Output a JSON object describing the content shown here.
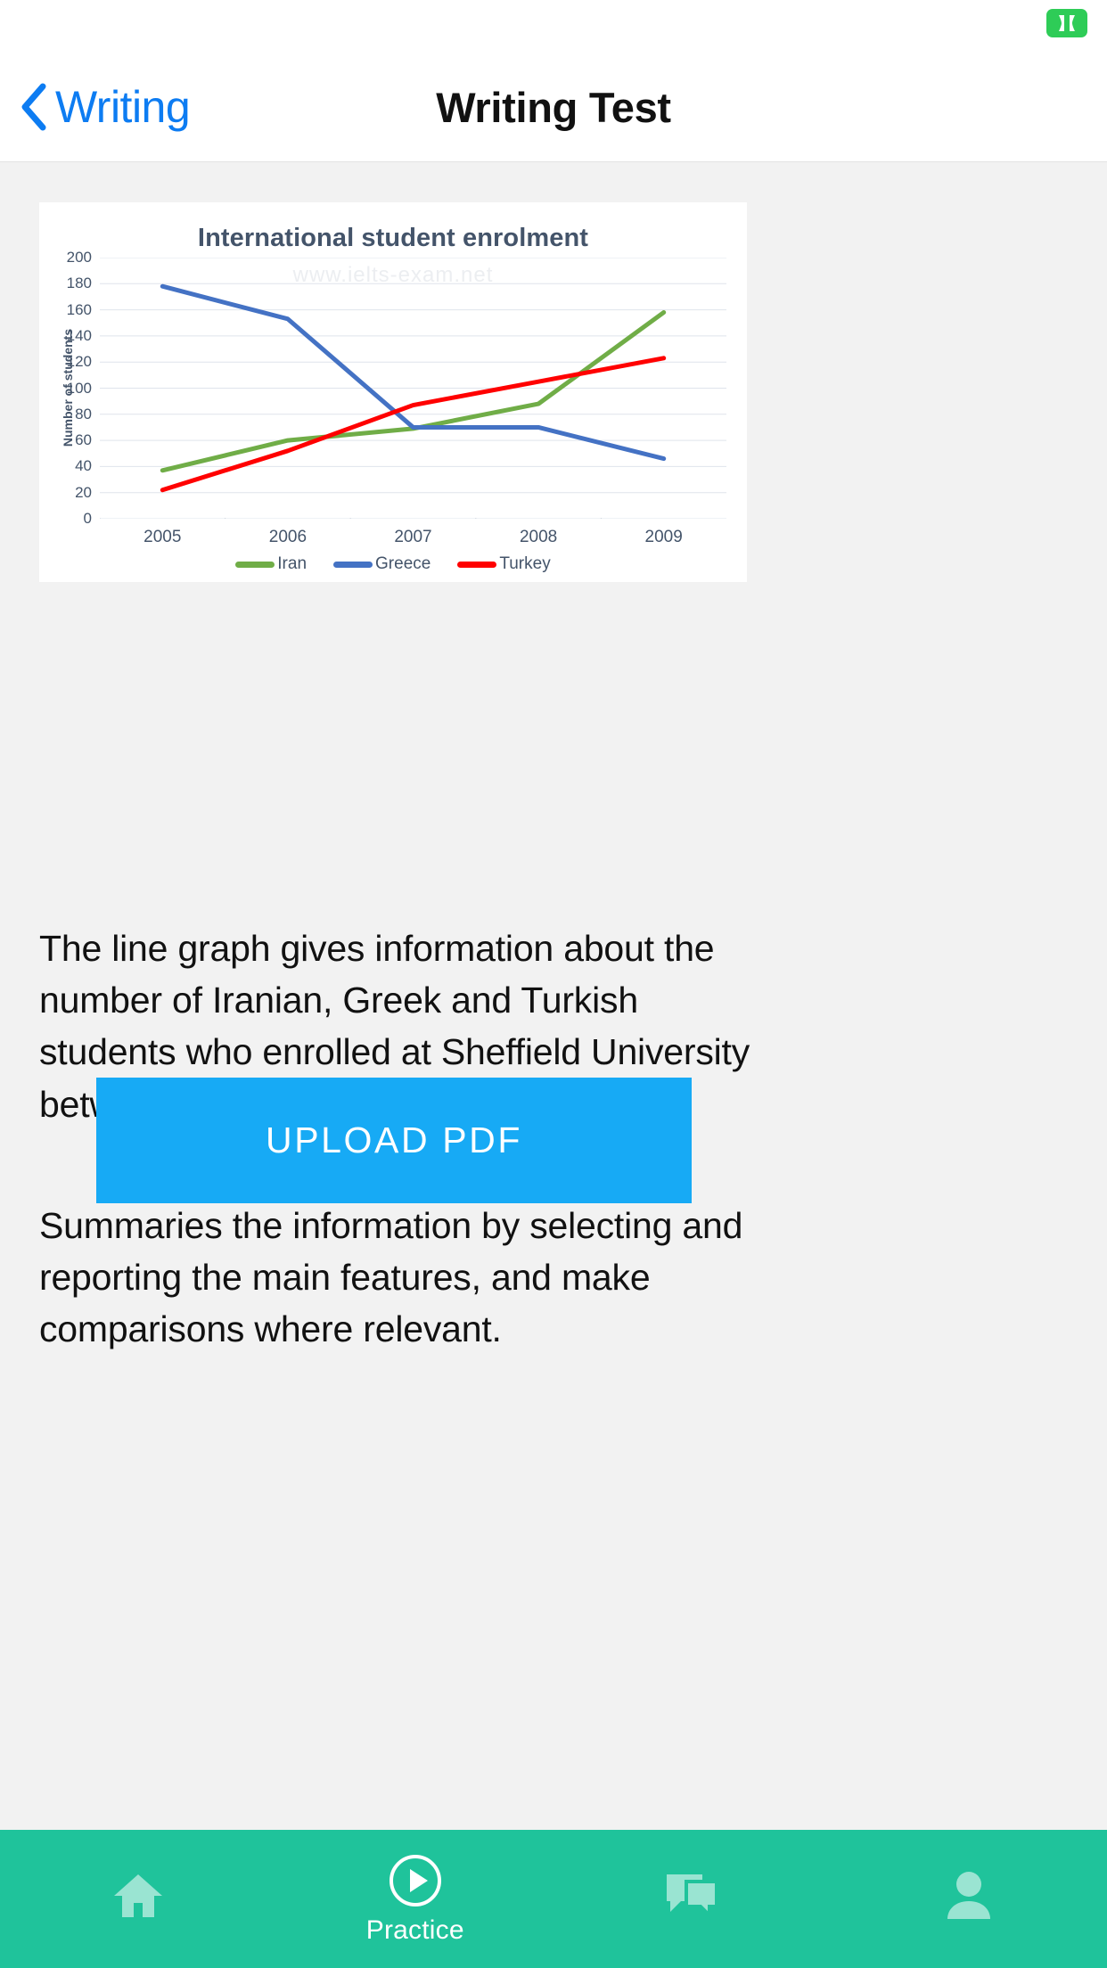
{
  "header": {
    "back_label": "Writing",
    "title": "Writing Test",
    "back_icon": "chevron-left-icon",
    "quote_icon": "quote-badge-icon"
  },
  "chart_data": {
    "type": "line",
    "title": "International student enrolment",
    "watermark": "www.ielts-exam.net",
    "xlabel": "",
    "ylabel": "Number of students",
    "categories": [
      "2005",
      "2006",
      "2007",
      "2008",
      "2009"
    ],
    "ylim": [
      0,
      200
    ],
    "yticks": [
      200,
      180,
      160,
      140,
      120,
      100,
      80,
      60,
      40,
      20,
      0
    ],
    "grid": true,
    "legend_position": "bottom",
    "series": [
      {
        "name": "Iran",
        "color": "#70ad47",
        "values": [
          37,
          60,
          69,
          88,
          158
        ]
      },
      {
        "name": "Greece",
        "color": "#4472c4",
        "values": [
          178,
          153,
          70,
          70,
          46
        ]
      },
      {
        "name": "Turkey",
        "color": "#ff0000",
        "values": [
          22,
          52,
          87,
          105,
          123
        ]
      }
    ]
  },
  "main": {
    "paragraph_1": "The line graph gives information about the number of Iranian, Greek and Turkish students who enrolled at Sheffield University between 2005 and 2009.",
    "paragraph_2": "Summaries the information by selecting and reporting the main features, and make comparisons where relevant.",
    "upload_label": "UPLOAD PDF"
  },
  "bottom_nav": {
    "items": [
      {
        "label": "",
        "icon": "home-icon"
      },
      {
        "label": "Practice",
        "icon": "play-circle-icon"
      },
      {
        "label": "",
        "icon": "chat-icon"
      },
      {
        "label": "",
        "icon": "person-icon"
      }
    ]
  },
  "colors": {
    "accent_blue": "#0d7cf2",
    "upload_blue": "#17aaf5",
    "nav_teal": "#1fc39b",
    "badge_green": "#2ecc57",
    "page_bg": "#f2f2f2"
  }
}
